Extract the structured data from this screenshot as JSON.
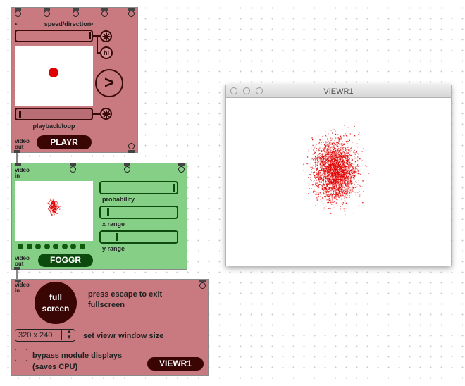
{
  "playr": {
    "speed_label": "speed/direction",
    "left_arrow": "<",
    "right_arrow": ">",
    "hi_label": "hi",
    "play_label": ">",
    "loop_label": "playback/loop",
    "video_out": "video\nout",
    "name": "PLAYR"
  },
  "foggr": {
    "video_in": "video\nin",
    "video_out": "video\nout",
    "name": "FOGGR",
    "probability_label": "probability",
    "xrange_label": "x range",
    "yrange_label": "y range",
    "dot_count": 8
  },
  "viewr_module": {
    "video_in": "video\nin",
    "fullscreen_label": "full\nscreen",
    "escape_text": "press escape to exit fullscreen",
    "size_value": "320 x 240",
    "size_label": "set viewr window size",
    "bypass_label": "bypass module displays\n(saves CPU)",
    "name": "VIEWR1"
  },
  "viewr_window": {
    "title": "VIEWR1"
  },
  "colors": {
    "pink": "#c97a80",
    "green": "#86cf86",
    "dark_red": "#3a0a0a",
    "dark_green": "#0d4a0d",
    "dot_red": "#e00000"
  }
}
